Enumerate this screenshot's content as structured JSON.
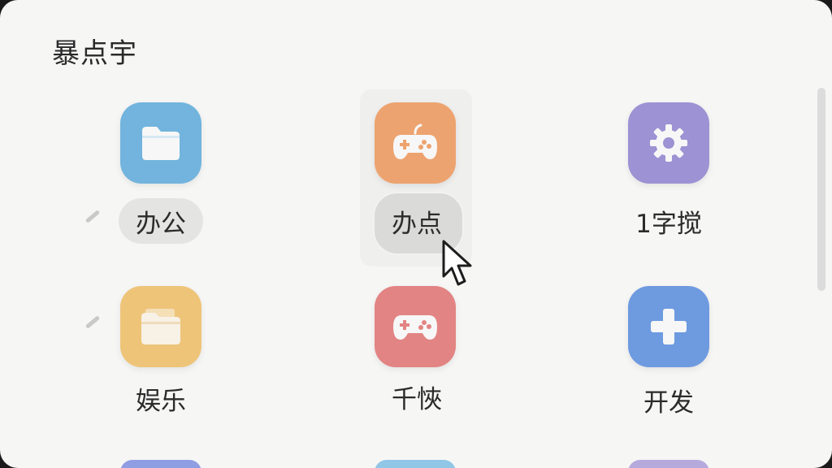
{
  "header": {
    "title": "暴点宇"
  },
  "grid": {
    "items": [
      {
        "label": "办公",
        "color": "#72b4dd",
        "icon": "folder-icon"
      },
      {
        "label": "办点",
        "color": "#eda36f",
        "icon": "gamepad-icon"
      },
      {
        "label": "1字搅",
        "color": "#9d92d3",
        "icon": "gear-icon"
      },
      {
        "label": "娱乐",
        "color": "#eec479",
        "icon": "open-folder-icon"
      },
      {
        "label": "千悏",
        "color": "#e28483",
        "icon": "gamepad-icon"
      },
      {
        "label": "开发",
        "color": "#6e9ae0",
        "icon": "plus-icon"
      }
    ]
  },
  "peek_colors": [
    "#8f9ee2",
    "#90c6e6",
    "#b6a9dc"
  ],
  "hover_index": 1
}
